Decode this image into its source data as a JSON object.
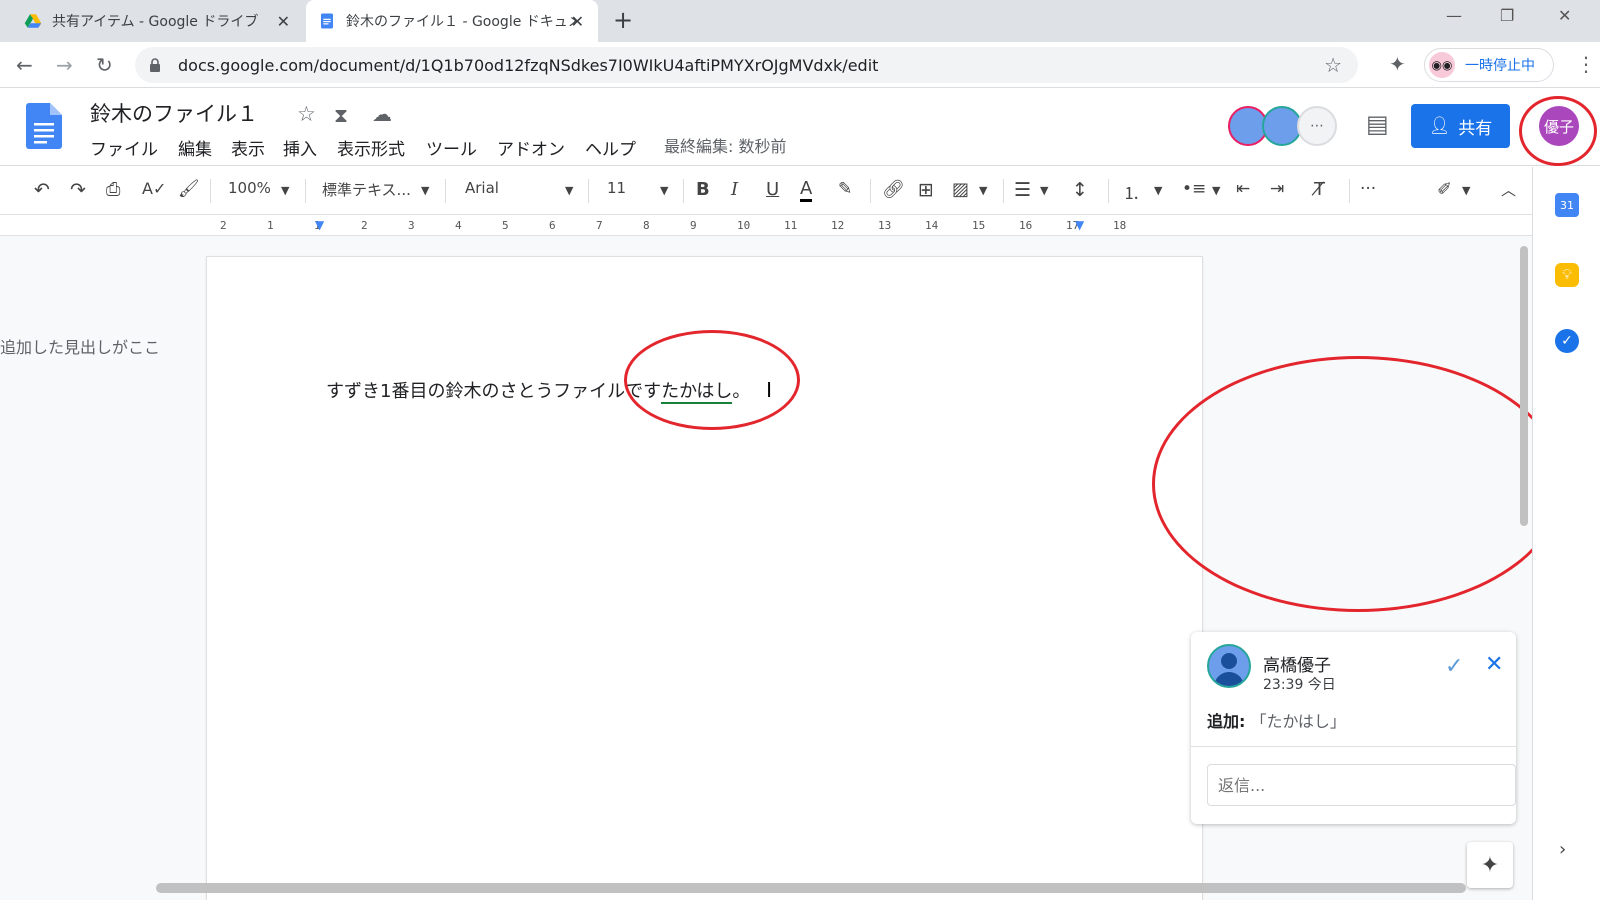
{
  "browser": {
    "tabs": [
      {
        "title": "共有アイテム - Google ドライブ"
      },
      {
        "title": "鈴木のファイル１ - Google ドキュメン"
      }
    ],
    "url": "docs.google.com/document/d/1Q1b70od12fzqNSdkes7I0WIkU4aftiPMYXrOJgMVdxk/edit",
    "profile_label": "一時停止中",
    "new_tab": "+",
    "window_controls": {
      "min": "—",
      "max": "❐",
      "close": "✕"
    }
  },
  "docs": {
    "title": "鈴木のファイル１",
    "menus": [
      "ファイル",
      "編集",
      "表示",
      "挿入",
      "表示形式",
      "ツール",
      "アドオン",
      "ヘルプ"
    ],
    "last_edit": "最終編集: 数秒前",
    "share_label": "共有",
    "user_avatar_label": "優子"
  },
  "toolbar": {
    "zoom": "100%",
    "style": "標準テキス...",
    "font": "Arial",
    "size": "11",
    "bold": "B",
    "italic": "I",
    "underline": "U",
    "text_color": "A",
    "more": "···"
  },
  "ruler": {
    "ticks": [
      "2",
      "1",
      "1",
      "2",
      "3",
      "4",
      "5",
      "6",
      "7",
      "8",
      "9",
      "10",
      "11",
      "12",
      "13",
      "14",
      "15",
      "16",
      "17",
      "18"
    ]
  },
  "outline": {
    "heading": "追加した見出しがここ"
  },
  "document": {
    "text_before": "すずき1番目の鈴木のさとうファイルです",
    "suggested_text": "たかはし",
    "text_after": "。"
  },
  "comment": {
    "author": "高橋優子",
    "time": "23:39 今日",
    "action_label": "追加:",
    "action_value": "「たかはし」",
    "reply_placeholder": "返信..."
  },
  "colors": {
    "accent": "#1a73e8",
    "suggestion_green": "#188038",
    "annotation_red": "#e3262d"
  }
}
